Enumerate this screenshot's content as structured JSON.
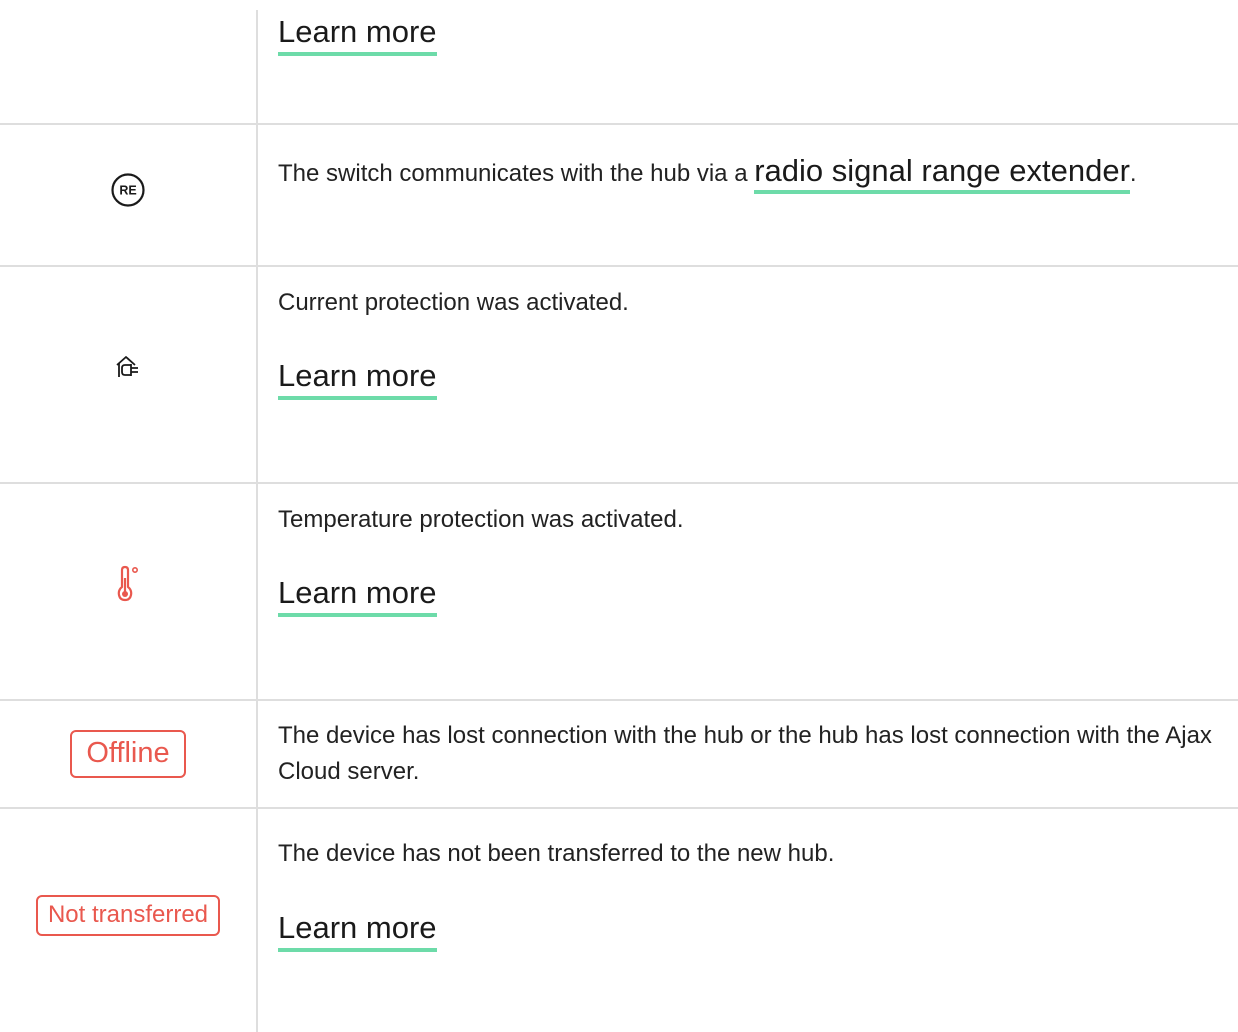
{
  "rows": [
    {
      "icon": "",
      "text": "",
      "link": "Learn more"
    },
    {
      "icon": "re-icon",
      "icon_text": "RE",
      "text_before": "The switch communicates with the hub via a ",
      "link": "radio signal range extender",
      "text_after": "."
    },
    {
      "icon": "current-protection-icon",
      "text": "Current protection was activated.",
      "link": "Learn more"
    },
    {
      "icon": "thermometer-icon",
      "text": "Temperature protection was activated.",
      "link": "Learn more"
    },
    {
      "icon": "offline-badge",
      "badge": "Offline",
      "text": "The device has lost connection with the hub or the hub has lost connection with the Ajax Cloud server."
    },
    {
      "icon": "not-transferred-badge",
      "badge": "Not transferred",
      "text": "The device has not been transferred to the new hub.",
      "link": "Learn more"
    }
  ],
  "colors": {
    "link_underline": "#6ddba9",
    "badge_red": "#e9584e",
    "thermometer_red": "#e9584e",
    "divider": "#dedede"
  }
}
